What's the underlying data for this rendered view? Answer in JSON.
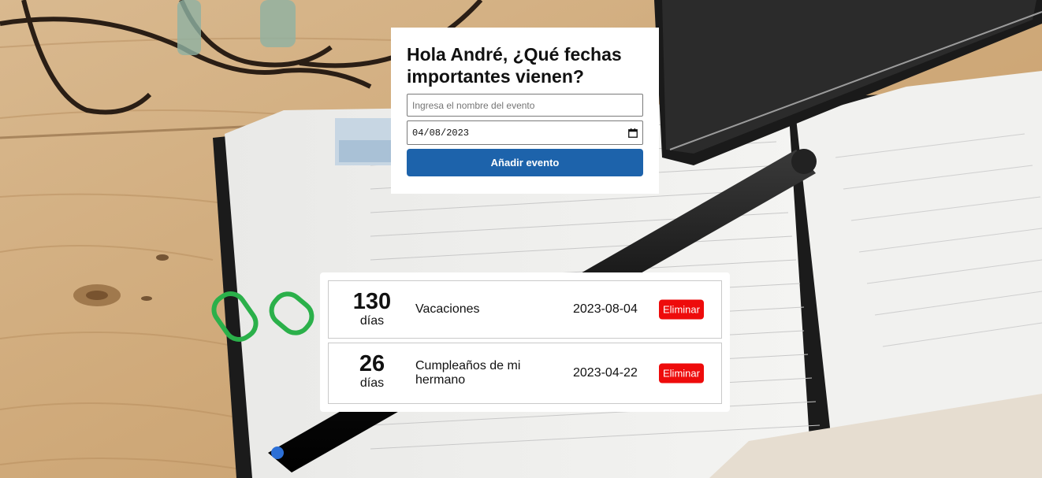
{
  "form": {
    "title": "Hola André, ¿Qué fechas importantes vienen?",
    "event_name_placeholder": "Ingresa el nombre del evento",
    "event_name_value": "",
    "date_value": "04/08/2023",
    "add_button_label": "Añadir evento"
  },
  "events": [
    {
      "days": "130",
      "days_label": "días",
      "name": "Vacaciones",
      "date": "2023-08-04",
      "delete_label": "Eliminar"
    },
    {
      "days": "26",
      "days_label": "días",
      "name": "Cumpleaños de mi hermano",
      "date": "2023-04-22",
      "delete_label": "Eliminar"
    }
  ],
  "colors": {
    "primary_button": "#1d63ab",
    "delete_button": "#ee0b0b",
    "card_background": "#ffffff"
  },
  "icons": {
    "date_picker": "calendar-icon"
  }
}
